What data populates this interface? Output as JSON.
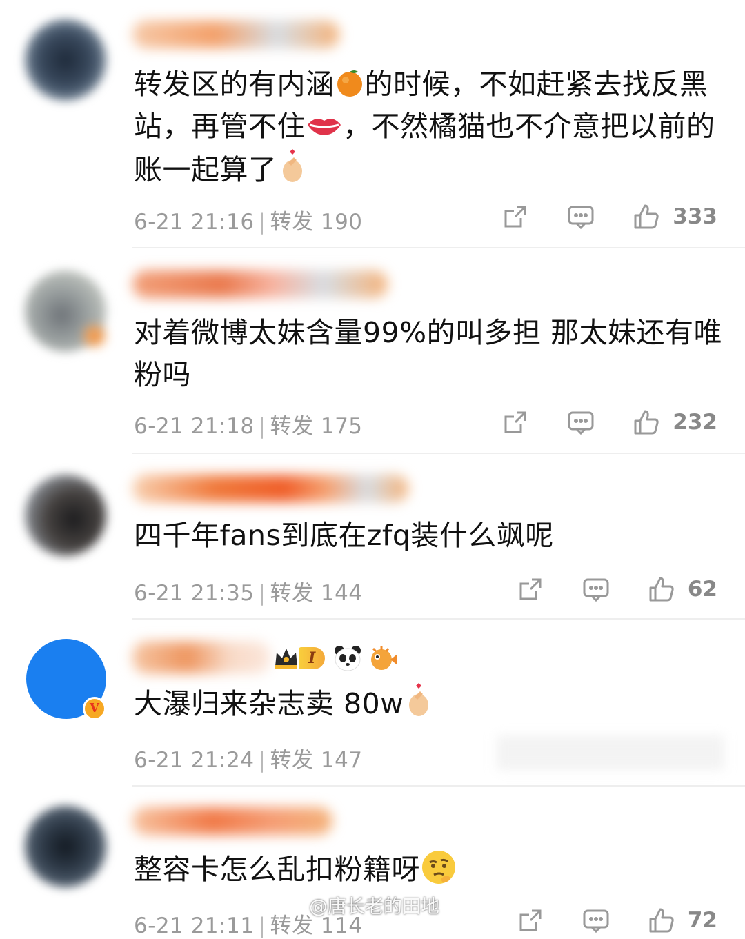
{
  "comments": [
    {
      "text_parts": [
        "转发区的有内涵",
        "的时候，不如赶紧去找反黑站，再管不住",
        "，不然橘猫也不介意把以前的账一起算了"
      ],
      "time": "6-21 21:16",
      "repost_label": "转发",
      "repost_count": "190",
      "likes": "333"
    },
    {
      "text": "对着微博太妹含量99%的叫多担 那太妹还有唯粉吗",
      "time": "6-21 21:18",
      "repost_label": "转发",
      "repost_count": "175",
      "likes": "232"
    },
    {
      "text": "四千年fans到底在zfq装什么飒呢",
      "time": "6-21 21:35",
      "repost_label": "转发",
      "repost_count": "144",
      "likes": "62"
    },
    {
      "text": "大瀑归来杂志卖 80w",
      "time": "6-21 21:24",
      "repost_label": "转发",
      "repost_count": "147",
      "badge_level": "I",
      "verified_mark": "V"
    },
    {
      "text": "整容卡怎么乱扣粉籍呀",
      "time": "6-21 21:11",
      "repost_label": "转发",
      "repost_count": "114",
      "likes": "72"
    }
  ],
  "separator": "|",
  "watermark": "@唐长老的田地",
  "icons": {
    "share": "share-icon",
    "comment": "comment-bubble-icon",
    "like": "thumbs-up-icon"
  },
  "colors": {
    "meta_gray": "#9a9a9a",
    "divider": "#eeeeee",
    "verified_blue": "#1a7ff0"
  }
}
